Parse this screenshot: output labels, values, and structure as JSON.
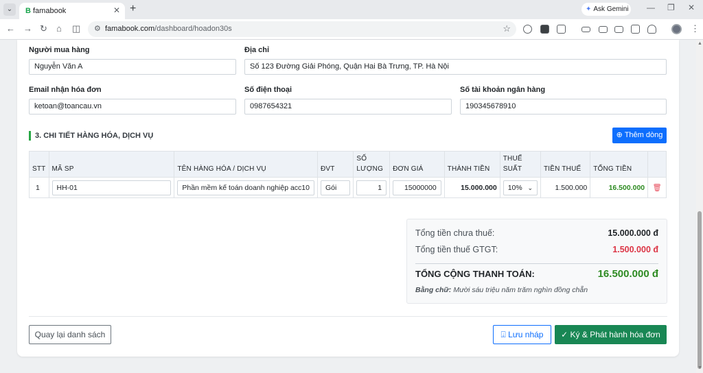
{
  "browser": {
    "tab_title": "famabook",
    "favicon": "B",
    "ask_gemini": "Ask Gemini",
    "url_host": "famabook.com",
    "url_path": "/dashboard/hoadon30s"
  },
  "buyer": {
    "name_label": "Người mua hàng",
    "name_value": "Nguyễn Văn A",
    "address_label": "Địa chỉ",
    "address_value": "Số 123 Đường Giải Phóng, Quận Hai Bà Trưng, TP. Hà Nội",
    "email_label": "Email nhận hóa đơn",
    "email_value": "ketoan@toancau.vn",
    "phone_label": "Số điện thoại",
    "phone_value": "0987654321",
    "bank_label": "Số tài khoản ngân hàng",
    "bank_value": "190345678910"
  },
  "items_section": {
    "title": "3. CHI TIẾT HÀNG HÓA, DỊCH VỤ",
    "add_row_label": "Thêm dòng",
    "headers": {
      "stt": "STT",
      "code": "MÃ SP",
      "name": "TÊN HÀNG HÓA / DỊCH VỤ",
      "unit": "ĐVT",
      "qty_1": "SỐ",
      "qty_2": "LƯỢNG",
      "price": "ĐƠN GIÁ",
      "amount": "THÀNH TIỀN",
      "tax_1": "THUẾ",
      "tax_2": "SUẤT",
      "tax_amount": "TIỀN THUẾ",
      "total": "TỔNG TIỀN"
    },
    "rows": [
      {
        "stt": "1",
        "code": "HH-01",
        "name": "Phần mềm kế toán doanh nghiệp acc10",
        "unit": "Gói",
        "qty": "1",
        "price": "15000000",
        "amount": "15.000.000",
        "tax_rate": "10%",
        "tax_amount": "1.500.000",
        "total": "16.500.000"
      }
    ]
  },
  "summary": {
    "subtotal_label": "Tổng tiền chưa thuế:",
    "subtotal_value": "15.000.000 đ",
    "vat_label": "Tổng tiền thuế GTGT:",
    "vat_value": "1.500.000 đ",
    "grand_label": "TỔNG CỘNG THANH TOÁN:",
    "grand_value": "16.500.000 đ",
    "words_label": "Bằng chữ:",
    "words_value": "Mười sáu triệu năm trăm nghìn đồng chẵn"
  },
  "actions": {
    "back": "Quay lại danh sách",
    "draft": "Lưu nháp",
    "sign": "Ký & Phát hành hóa đơn"
  },
  "colors": {
    "primary": "#0d6efd",
    "success": "#198754",
    "total_green": "#2e8b22",
    "danger": "#dc3545"
  }
}
